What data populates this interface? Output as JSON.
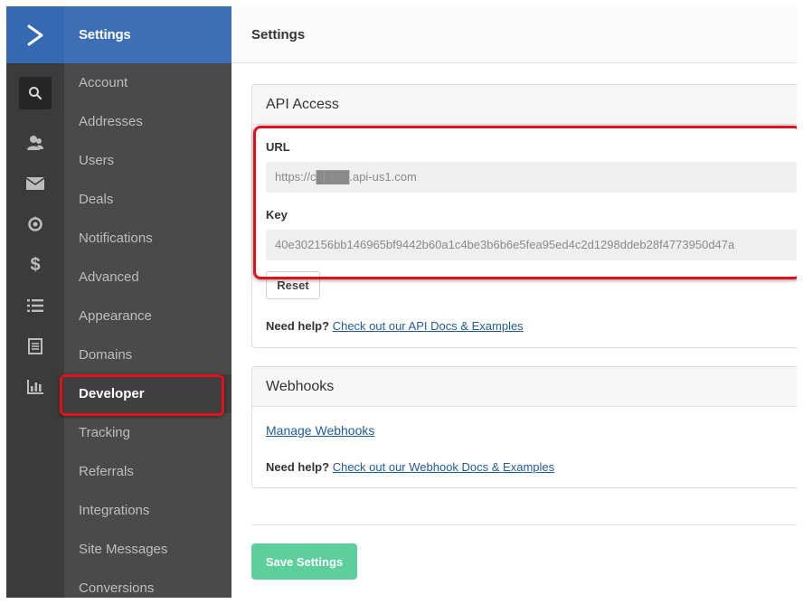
{
  "app": {
    "title": "Settings",
    "accent": "#356ab2",
    "save_color": "#5ccf9d"
  },
  "rail": {
    "icons": [
      "search-icon",
      "contacts-icon",
      "mail-icon",
      "automation-icon",
      "deals-icon",
      "lists-icon",
      "forms-icon",
      "reports-icon"
    ]
  },
  "nav": {
    "title": "Settings",
    "items": [
      {
        "label": "Account"
      },
      {
        "label": "Addresses"
      },
      {
        "label": "Users"
      },
      {
        "label": "Deals"
      },
      {
        "label": "Notifications"
      },
      {
        "label": "Advanced"
      },
      {
        "label": "Appearance"
      },
      {
        "label": "Domains"
      },
      {
        "label": "Developer",
        "active": true
      },
      {
        "label": "Tracking"
      },
      {
        "label": "Referrals"
      },
      {
        "label": "Integrations"
      },
      {
        "label": "Site Messages"
      },
      {
        "label": "Conversions"
      }
    ]
  },
  "main": {
    "title": "Settings"
  },
  "api": {
    "title": "API Access",
    "url_label": "URL",
    "url_value": "https://c████.api-us1.com",
    "key_label": "Key",
    "key_value": "40e302156bb146965bf9442b60a1c4be3b6b6e5fea95ed4c2d1298ddeb28f4773950d47a",
    "reset_label": "Reset",
    "help_prefix": "Need help?",
    "help_link": "Check out our API Docs & Examples"
  },
  "webhooks": {
    "title": "Webhooks",
    "manage_link": "Manage Webhooks",
    "help_prefix": "Need help?",
    "help_link": "Check out our Webhook Docs & Examples"
  },
  "footer": {
    "save_label": "Save Settings"
  }
}
